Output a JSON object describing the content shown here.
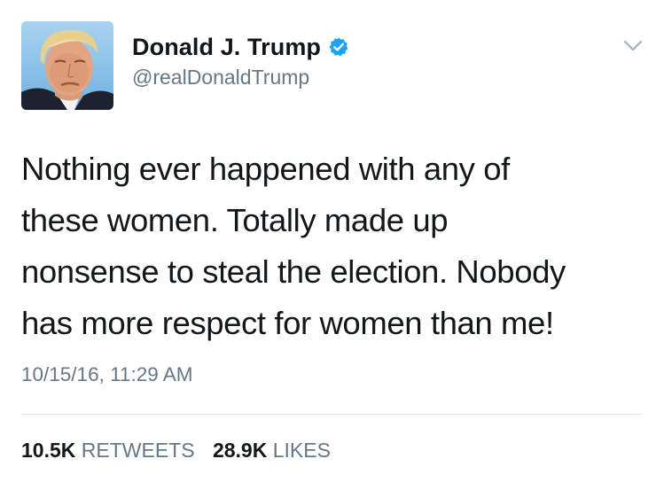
{
  "author": {
    "display_name": "Donald J. Trump",
    "handle": "@realDonaldTrump",
    "verified": true,
    "verified_icon": "verified-badge-icon",
    "verified_color": "#1da1f2"
  },
  "menu": {
    "icon": "chevron-down-icon"
  },
  "tweet": {
    "lines": [
      "Nothing ever happened with any of",
      "these women. Totally made up",
      "nonsense to steal the election. Nobody",
      "has more respect for women than me!"
    ],
    "timestamp": "10/15/16, 11:29 AM"
  },
  "stats": {
    "retweets_count": "10.5K",
    "retweets_label": "RETWEETS",
    "likes_count": "28.9K",
    "likes_label": "LIKES"
  }
}
